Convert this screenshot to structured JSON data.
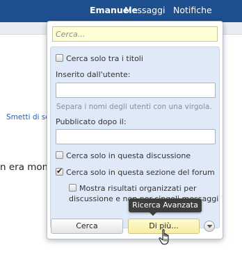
{
  "header": {
    "user": "Emanuele",
    "messages": "Messaggi",
    "notifications": "Notifiche"
  },
  "background": {
    "link_fragment": "Smetti di se",
    "text_fragment": "n era mom"
  },
  "search_popup": {
    "input_placeholder": "Cerca...",
    "input_value": "",
    "titles_only_label": "Cerca solo tra i titoli",
    "titles_only_checked": false,
    "posted_by_label": "Inserito dall'utente:",
    "posted_by_value": "",
    "posted_by_hint": "Separa i nomi degli utenti con una virgola.",
    "newer_than_label": "Pubblicato dopo il:",
    "newer_than_value": "",
    "this_thread_label": "Cerca solo in questa discussione",
    "this_thread_checked": false,
    "this_forum_label": "Cerca solo in questa sezione del forum",
    "this_forum_checked": true,
    "group_results_label": "Mostra risultati organizzati per discussione e non per singoli messaggi",
    "group_results_checked": false,
    "search_button": "Cerca",
    "more_button": "Di più...",
    "tooltip": "Ricerca Avanzata"
  },
  "colors": {
    "header_bg": "#1e4f8f",
    "panel_bg": "#dfe9f7",
    "input_bg": "#ffffd6",
    "more_button_bg": "#fffbd0",
    "tooltip_bg": "#3d3d3d"
  },
  "icons": {
    "collapse": "chevron-down-icon",
    "pointer": "hand-cursor-icon"
  }
}
